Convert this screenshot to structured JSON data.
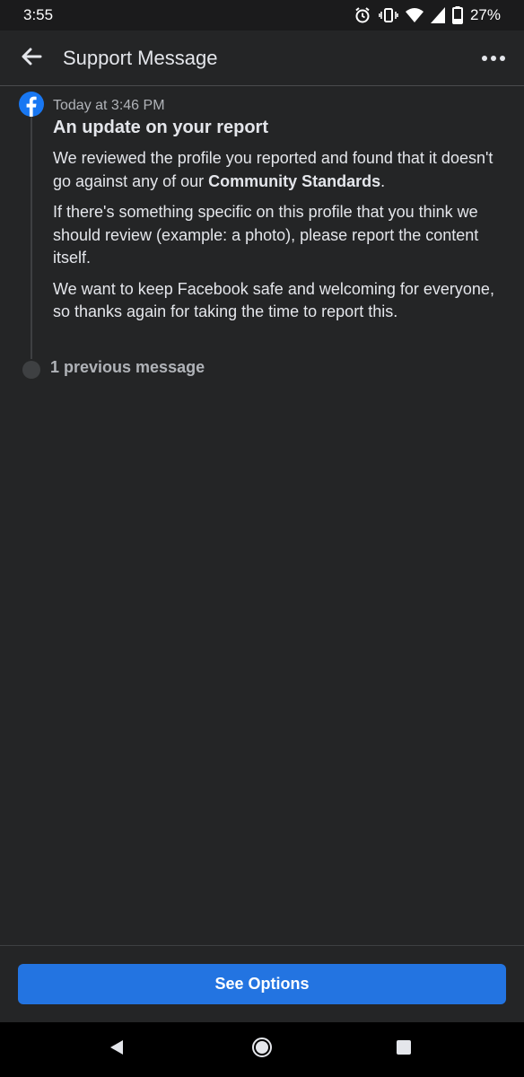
{
  "status_bar": {
    "time": "3:55",
    "battery": "27%",
    "icons": [
      "alarm-icon",
      "vibrate-icon",
      "wifi-icon",
      "signal-icon",
      "battery-icon"
    ]
  },
  "app_bar": {
    "title": "Support Message",
    "back_icon": "arrow-left-icon",
    "more_icon": "more-horizontal-icon"
  },
  "message": {
    "sender_icon": "facebook-logo-icon",
    "timestamp": "Today at 3:46 PM",
    "title": "An update on your report",
    "paragraph1_text": "We reviewed the profile you reported and found that it doesn't go against any of our ",
    "paragraph1_bold": "Community Standards",
    "paragraph1_end": ".",
    "paragraph2": "If there's something specific on this profile that you think we should review (example: a photo), please report the content itself.",
    "paragraph3": "We want to keep Facebook safe and welcoming for everyone, so thanks again for taking the time to report this."
  },
  "previous": {
    "label": "1 previous message"
  },
  "actions": {
    "see_options": "See Options"
  },
  "nav_bar": {
    "icons": [
      "nav-back-icon",
      "nav-home-icon",
      "nav-recents-icon"
    ]
  },
  "colors": {
    "background": "#242526",
    "text_primary": "#e4e6eb",
    "text_secondary": "#b0b3b8",
    "accent": "#2374e1"
  }
}
